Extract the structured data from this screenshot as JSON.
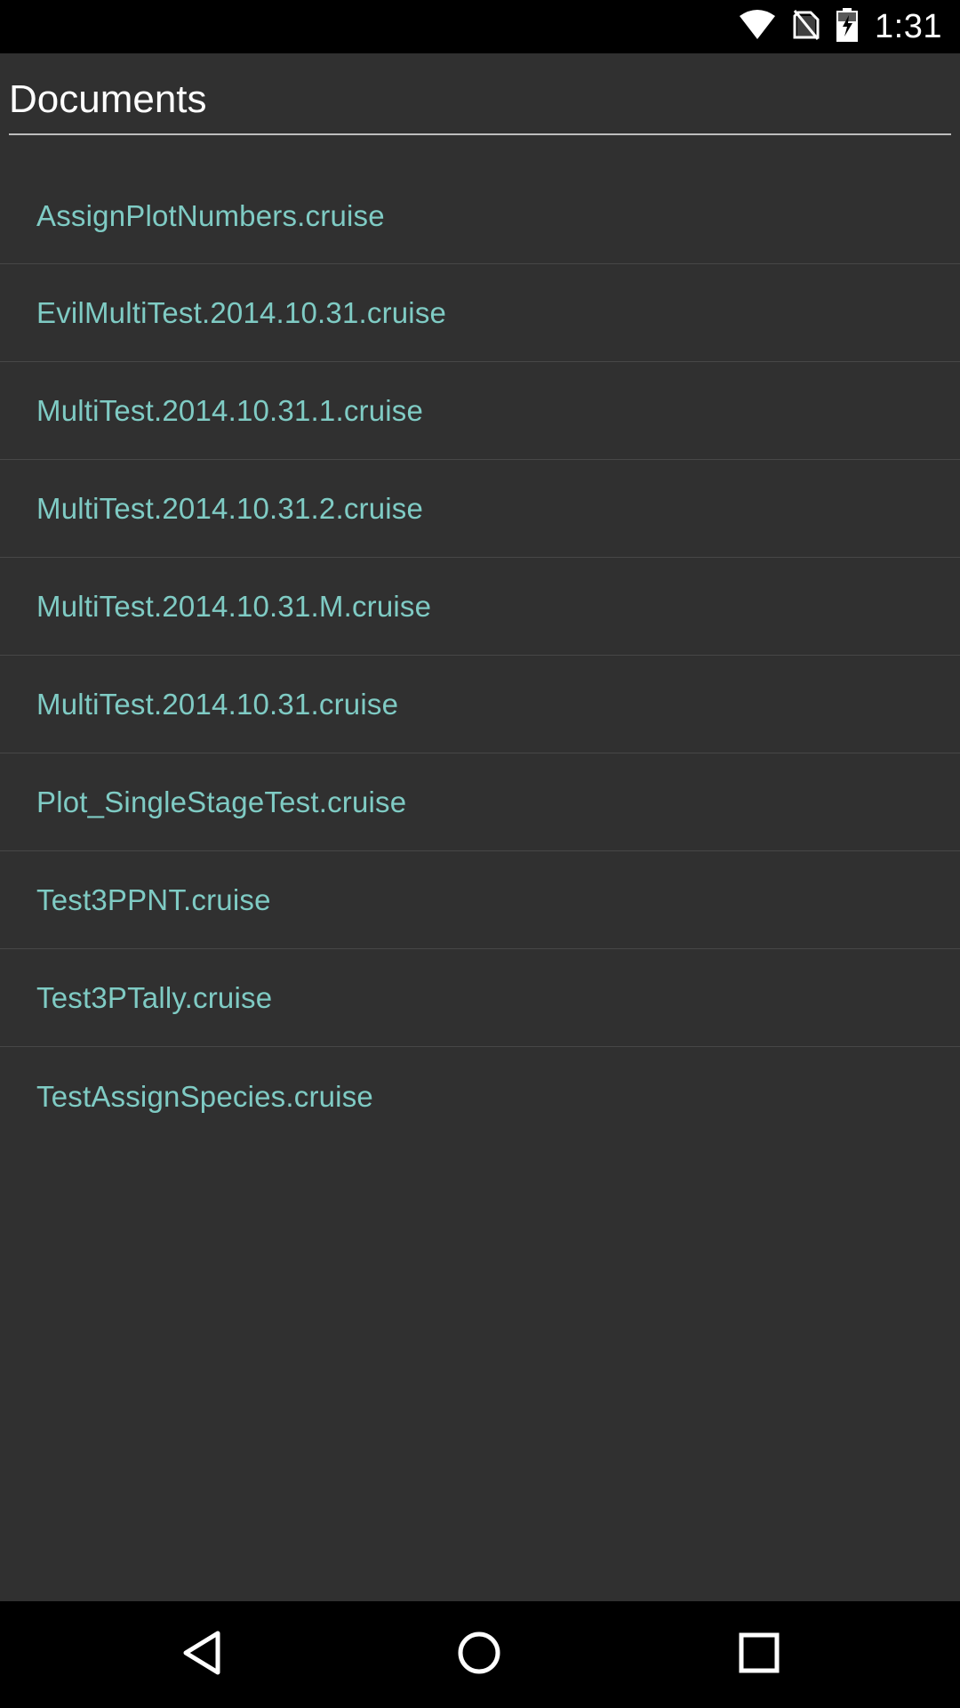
{
  "status_bar": {
    "time": "1:31",
    "icons": [
      "wifi-icon",
      "no-sim-icon",
      "battery-charging-icon"
    ]
  },
  "header": {
    "title": "Documents"
  },
  "documents": [
    {
      "label": "AssignPlotNumbers.cruise"
    },
    {
      "label": "EvilMultiTest.2014.10.31.cruise"
    },
    {
      "label": "MultiTest.2014.10.31.1.cruise"
    },
    {
      "label": "MultiTest.2014.10.31.2.cruise"
    },
    {
      "label": "MultiTest.2014.10.31.M.cruise"
    },
    {
      "label": "MultiTest.2014.10.31.cruise"
    },
    {
      "label": "Plot_SingleStageTest.cruise"
    },
    {
      "label": "Test3PPNT.cruise"
    },
    {
      "label": "Test3PTally.cruise"
    },
    {
      "label": "TestAssignSpecies.cruise"
    }
  ],
  "nav_bar": {
    "buttons": [
      "back-icon",
      "home-icon",
      "recents-icon"
    ]
  },
  "colors": {
    "background": "#303030",
    "accent_text": "#7fcbc4",
    "bars": "#000000"
  }
}
